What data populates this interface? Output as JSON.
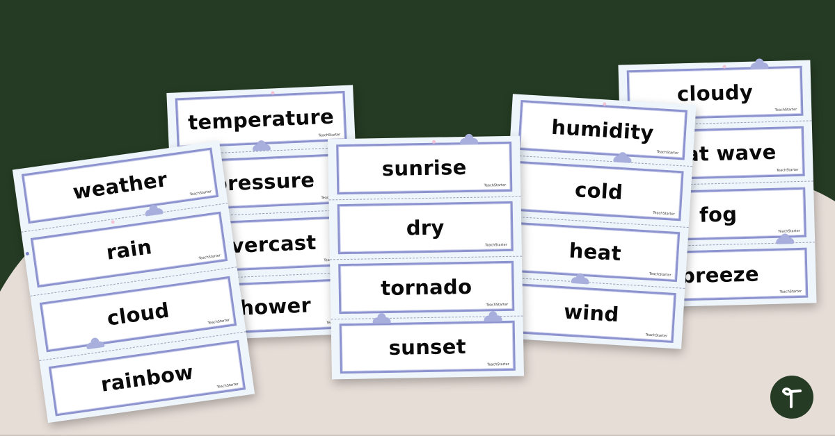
{
  "colors": {
    "background_dark": "#253b23",
    "background_beige": "#e7ddd7",
    "sheet_background": "#eef5fb",
    "card_border": "#8c93cf",
    "word_text": "#0a0a0a"
  },
  "brand_mark": "TeachStarter",
  "logo": {
    "icon": "teach-starter-logo-icon"
  },
  "sheets": [
    {
      "words": [
        "weather",
        "rain",
        "cloud",
        "rainbow"
      ]
    },
    {
      "words": [
        "temperature",
        "pressure",
        "overcast",
        "shower"
      ]
    },
    {
      "words": [
        "sunrise",
        "dry",
        "tornado",
        "sunset"
      ]
    },
    {
      "words": [
        "humidity",
        "cold",
        "heat",
        "wind"
      ]
    },
    {
      "words": [
        "cloudy",
        "heat wave",
        "fog",
        "breeze"
      ]
    }
  ]
}
